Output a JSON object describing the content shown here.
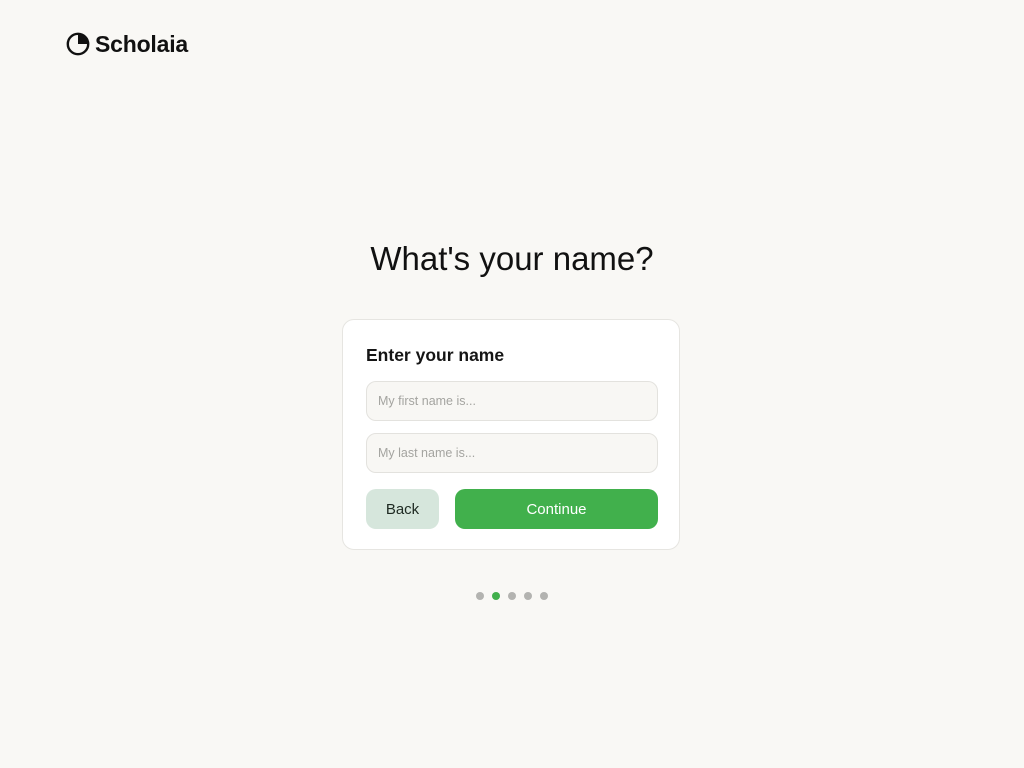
{
  "brand": {
    "name": "Scholaia",
    "icon": "pie-chart-logo-icon"
  },
  "heading": "What's your name?",
  "form": {
    "title": "Enter your name",
    "first_name": {
      "value": "",
      "placeholder": "My first name is..."
    },
    "last_name": {
      "value": "",
      "placeholder": "My last name is..."
    },
    "back_label": "Back",
    "continue_label": "Continue"
  },
  "progress": {
    "total_steps": 5,
    "current_step": 2
  },
  "colors": {
    "background": "#f9f8f5",
    "accent": "#41b04c",
    "back_button": "#d6e6dc",
    "inactive_dot": "#b3b3b0"
  }
}
